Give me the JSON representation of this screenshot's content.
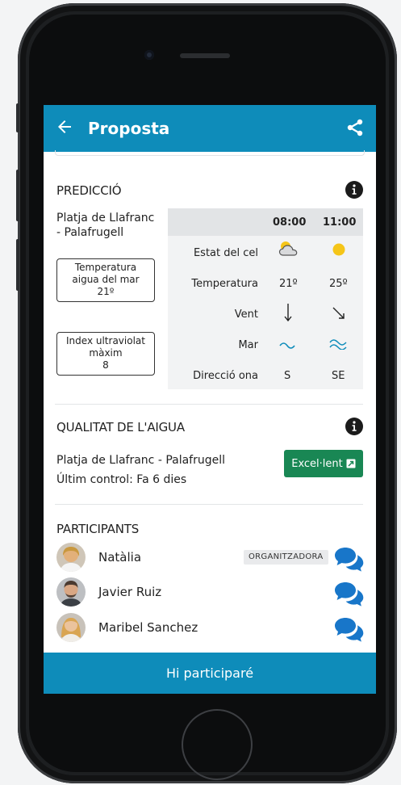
{
  "header": {
    "title": "Proposta"
  },
  "prediccio": {
    "title": "PREDICCIÓ",
    "place": "Platja de Llafranc - Palafrugell",
    "water_temp": {
      "label": "Temperatura aigua del mar",
      "value": "21º"
    },
    "uv": {
      "label": "Index ultraviolat màxim",
      "value": "8"
    },
    "times": [
      "08:00",
      "11:00"
    ],
    "rows": {
      "sky": {
        "label": "Estat del cel",
        "values": [
          "partly-cloudy-icon",
          "sun-icon"
        ]
      },
      "temp": {
        "label": "Temperatura",
        "values": [
          "21º",
          "25º"
        ]
      },
      "wind": {
        "label": "Vent",
        "values": [
          "arrow-down-icon",
          "arrow-down-right-icon"
        ]
      },
      "sea": {
        "label": "Mar",
        "values": [
          "wave-small-icon",
          "wave-medium-icon"
        ]
      },
      "wave_dir": {
        "label": "Direcció ona",
        "values": [
          "S",
          "SE"
        ]
      }
    }
  },
  "qualitat": {
    "title": "QUALITAT DE L'AIGUA",
    "text": "Platja de Llafranc - Palafrugell Últim control: Fa 6 dies",
    "button": "Excel·lent"
  },
  "participants": {
    "title": "PARTICIPANTS",
    "items": [
      {
        "name": "Natàlia",
        "badge": "ORGANITZADORA"
      },
      {
        "name": "Javier Ruiz"
      },
      {
        "name": "Maribel Sanchez"
      }
    ]
  },
  "bottom_button": "Hi participaré",
  "colors": {
    "primary": "#0e8cba",
    "success": "#198754",
    "sun": "#f5c518"
  }
}
